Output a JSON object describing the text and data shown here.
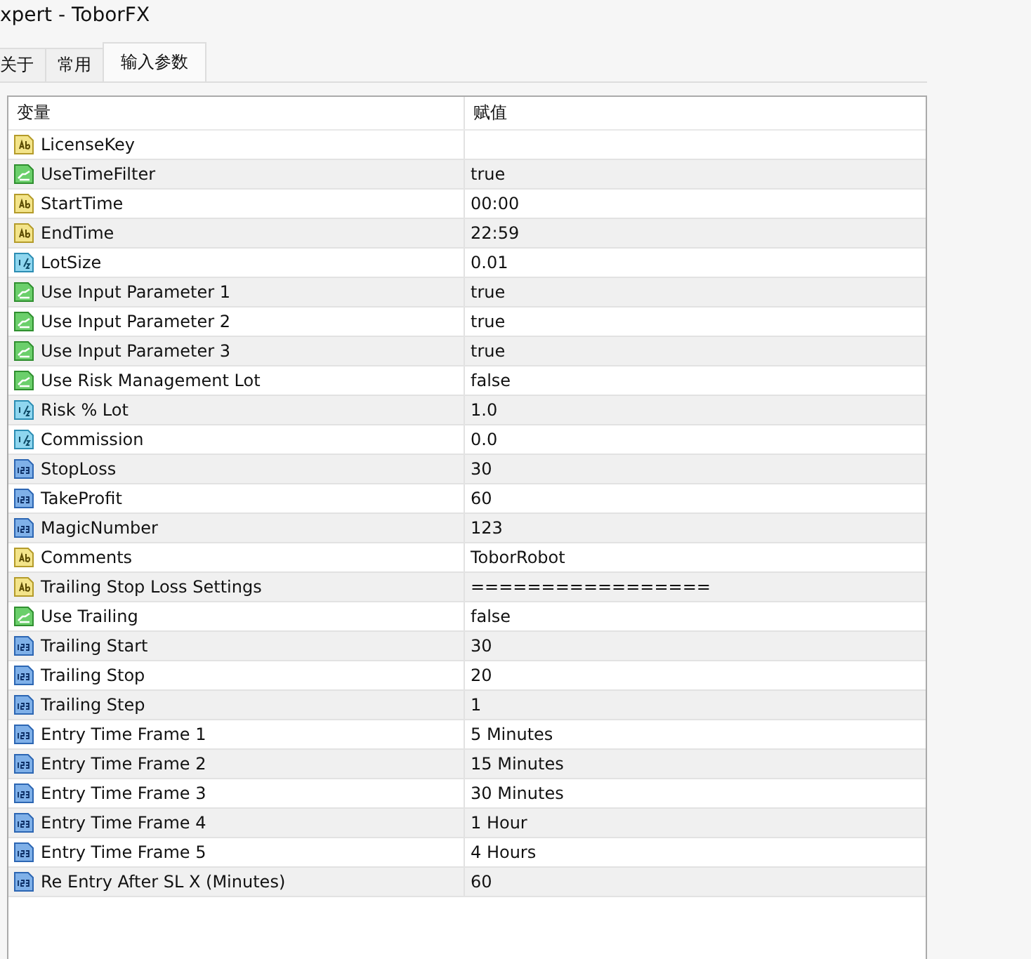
{
  "window": {
    "title": "xpert - ToborFX"
  },
  "tabs": [
    {
      "label": "关于",
      "selected": false
    },
    {
      "label": "常用",
      "selected": false
    },
    {
      "label": "输入参数",
      "selected": true
    }
  ],
  "table": {
    "columns": [
      "变量",
      "赋值"
    ],
    "rows": [
      {
        "kind": "string",
        "name": "LicenseKey",
        "value": ""
      },
      {
        "kind": "bool",
        "name": "UseTimeFilter",
        "value": "true"
      },
      {
        "kind": "string",
        "name": "StartTime",
        "value": "00:00"
      },
      {
        "kind": "string",
        "name": "EndTime",
        "value": "22:59"
      },
      {
        "kind": "double",
        "name": "LotSize",
        "value": "0.01"
      },
      {
        "kind": "bool",
        "name": "Use Input Parameter 1",
        "value": "true"
      },
      {
        "kind": "bool",
        "name": "Use Input Parameter 2",
        "value": "true"
      },
      {
        "kind": "bool",
        "name": "Use Input Parameter 3",
        "value": "true"
      },
      {
        "kind": "bool",
        "name": "Use Risk Management Lot",
        "value": "false"
      },
      {
        "kind": "double",
        "name": "Risk % Lot",
        "value": "1.0"
      },
      {
        "kind": "double",
        "name": "Commission",
        "value": "0.0"
      },
      {
        "kind": "int",
        "name": "StopLoss",
        "value": "30"
      },
      {
        "kind": "int",
        "name": "TakeProfit",
        "value": "60"
      },
      {
        "kind": "int",
        "name": "MagicNumber",
        "value": "123"
      },
      {
        "kind": "string",
        "name": "Comments",
        "value": "ToborRobot"
      },
      {
        "kind": "string",
        "name": "Trailing Stop Loss Settings",
        "value": "================="
      },
      {
        "kind": "bool",
        "name": "Use Trailing",
        "value": "false"
      },
      {
        "kind": "int",
        "name": "Trailing Start",
        "value": "30"
      },
      {
        "kind": "int",
        "name": "Trailing Stop",
        "value": "20"
      },
      {
        "kind": "int",
        "name": "Trailing Step",
        "value": "1"
      },
      {
        "kind": "int",
        "name": "Entry Time Frame 1",
        "value": "5 Minutes"
      },
      {
        "kind": "int",
        "name": "Entry Time Frame 2",
        "value": "15 Minutes"
      },
      {
        "kind": "int",
        "name": "Entry Time Frame 3",
        "value": "30 Minutes"
      },
      {
        "kind": "int",
        "name": "Entry Time Frame 4",
        "value": "1 Hour"
      },
      {
        "kind": "int",
        "name": "Entry Time Frame 5",
        "value": "4 Hours"
      },
      {
        "kind": "int",
        "name": "Re Entry After SL X (Minutes)",
        "value": "60"
      }
    ]
  }
}
